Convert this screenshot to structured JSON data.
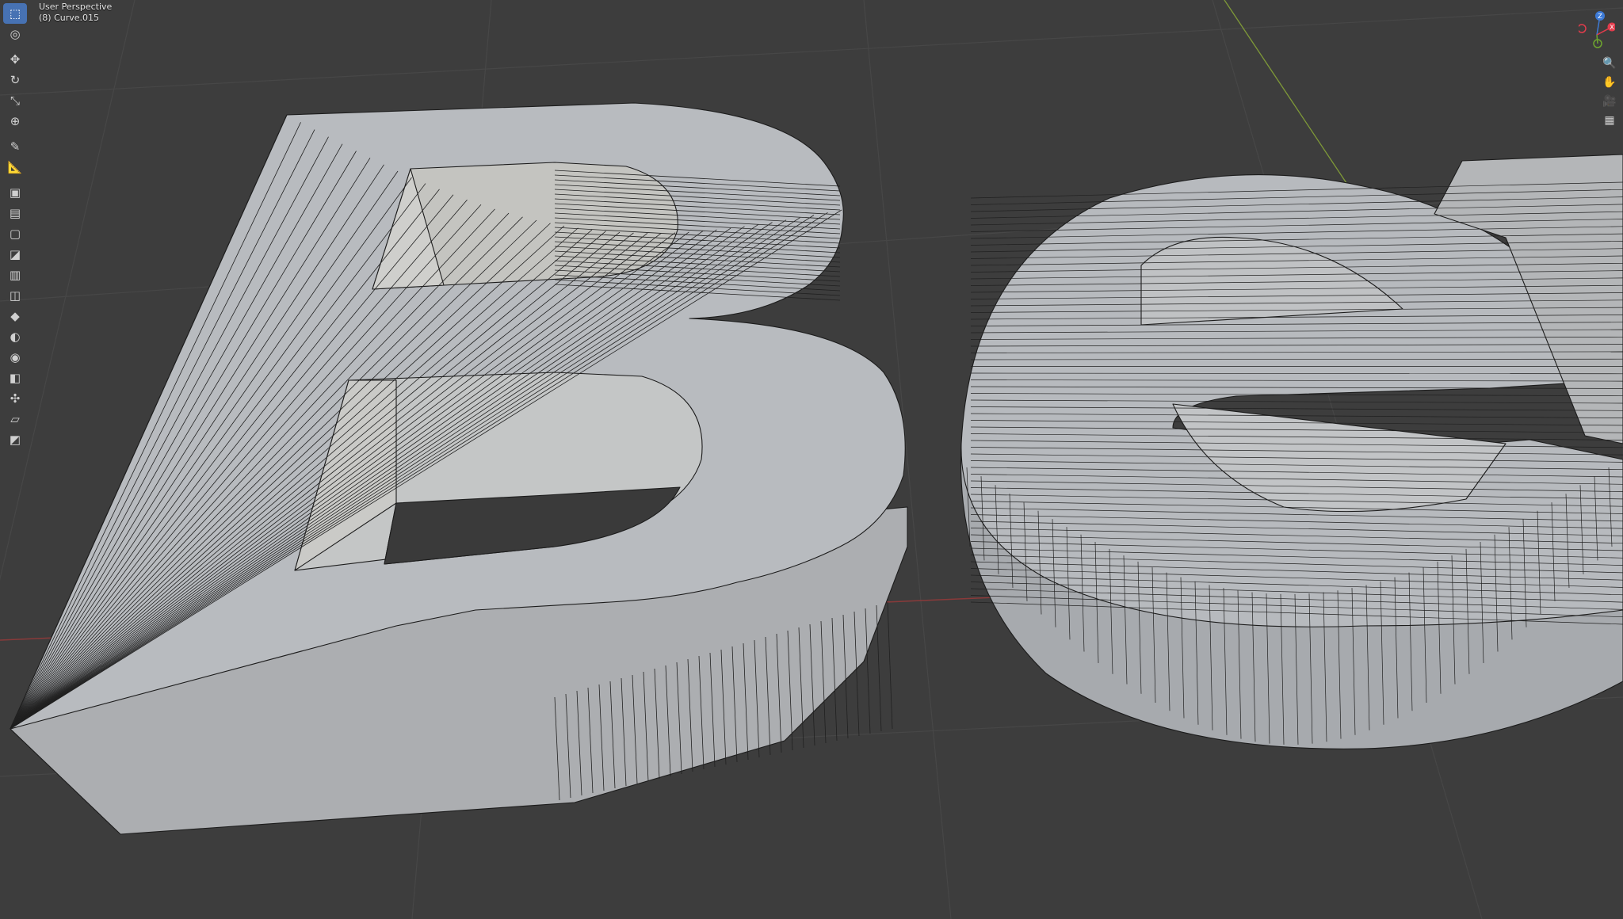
{
  "viewport": {
    "view_name": "User Perspective",
    "object_label": "(8) Curve.015"
  },
  "toolbar": {
    "tools": [
      {
        "name": "select-box-tool",
        "glyph": "⬚",
        "active": true
      },
      {
        "name": "cursor-tool",
        "glyph": "◎"
      },
      {
        "name": "move-tool",
        "glyph": "✥"
      },
      {
        "name": "rotate-tool",
        "glyph": "↻"
      },
      {
        "name": "scale-tool",
        "glyph": "⤡"
      },
      {
        "name": "transform-tool",
        "glyph": "⊕"
      },
      {
        "name": "annotate-tool",
        "glyph": "✎"
      },
      {
        "name": "measure-tool",
        "glyph": "📐"
      },
      {
        "name": "add-cube-tool",
        "glyph": "▣"
      },
      {
        "name": "extrude-tool",
        "glyph": "▤"
      },
      {
        "name": "inset-tool",
        "glyph": "▢"
      },
      {
        "name": "bevel-tool",
        "glyph": "◪"
      },
      {
        "name": "loop-cut-tool",
        "glyph": "▥"
      },
      {
        "name": "knife-tool",
        "glyph": "◫"
      },
      {
        "name": "poly-build-tool",
        "glyph": "◆"
      },
      {
        "name": "spin-tool",
        "glyph": "◐"
      },
      {
        "name": "smooth-tool",
        "glyph": "◉"
      },
      {
        "name": "edge-slide-tool",
        "glyph": "◧"
      },
      {
        "name": "shrink-fatten-tool",
        "glyph": "✣"
      },
      {
        "name": "shear-tool",
        "glyph": "▱"
      },
      {
        "name": "rip-region-tool",
        "glyph": "◩"
      }
    ]
  },
  "gizmo": {
    "axis_labels": {
      "z": "Z",
      "x": "X"
    },
    "colors": {
      "x": "#e23c4c",
      "y": "#6ea52f",
      "z": "#3d7ad6"
    }
  },
  "nav_buttons": [
    {
      "name": "zoom-icon",
      "glyph": "🔍"
    },
    {
      "name": "pan-hand-icon",
      "glyph": "✋"
    },
    {
      "name": "camera-view-icon",
      "glyph": "🎥"
    },
    {
      "name": "grid-ortho-icon",
      "glyph": "▦"
    }
  ],
  "colors": {
    "background": "#3d3d3d",
    "grid_line": "#474747",
    "axis_x": "#c14b4b",
    "axis_y": "#86a83a",
    "mesh_top": "#b9bcc0",
    "mesh_side": "#a9acb0",
    "wire": "#1a1a1a",
    "active_tool": "#4772b3"
  }
}
